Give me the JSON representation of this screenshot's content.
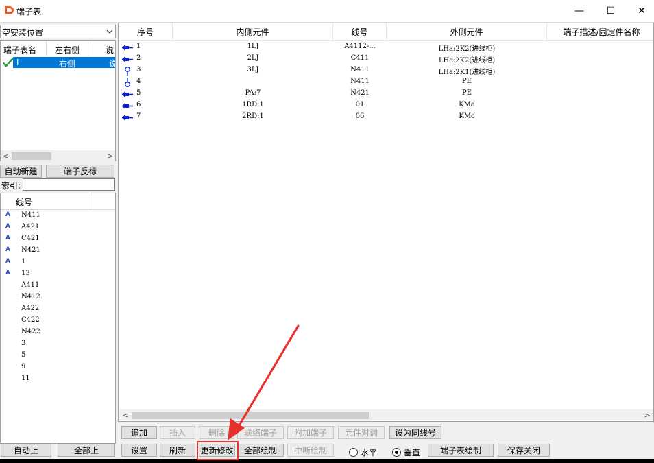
{
  "window": {
    "title": "端子表",
    "minimize": "—",
    "maximize": "☐",
    "close": "✕"
  },
  "left": {
    "combo_value": "空安装位置",
    "terminal_list": {
      "columns": [
        "端子表名",
        "左右侧",
        "说"
      ],
      "rows": [
        {
          "name": "I",
          "side": "右侧",
          "extra": "说"
        }
      ]
    },
    "buttons": {
      "auto_new": "自动新建",
      "reverse": "端子反标"
    },
    "search": {
      "label": "索引:",
      "value": ""
    },
    "wire_list": {
      "column": "线号",
      "items": [
        {
          "text": "N411",
          "flag": "A"
        },
        {
          "text": "A421",
          "flag": "A"
        },
        {
          "text": "C421",
          "flag": "A"
        },
        {
          "text": "N421",
          "flag": "A"
        },
        {
          "text": "1",
          "flag": "A"
        },
        {
          "text": "13",
          "flag": "A"
        },
        {
          "text": "A411",
          "flag": ""
        },
        {
          "text": "N412",
          "flag": ""
        },
        {
          "text": "A422",
          "flag": ""
        },
        {
          "text": "C422",
          "flag": ""
        },
        {
          "text": "N422",
          "flag": ""
        },
        {
          "text": "3",
          "flag": ""
        },
        {
          "text": "5",
          "flag": ""
        },
        {
          "text": "9",
          "flag": ""
        },
        {
          "text": "11",
          "flag": ""
        }
      ]
    },
    "bottom_buttons": {
      "auto_up": "自动上",
      "all_up": "全部上"
    }
  },
  "table": {
    "columns": [
      "序号",
      "内侧元件",
      "线号",
      "外侧元件",
      "端子描述/固定件名称"
    ],
    "rows": [
      {
        "no": "1",
        "inner": "1LJ",
        "wire": "A4112-...",
        "outer": "LHa:2K2(进线柜)",
        "desc": "",
        "icon": "arrow"
      },
      {
        "no": "2",
        "inner": "2LJ",
        "wire": "C411",
        "outer": "LHc:2K2(进线柜)",
        "desc": "",
        "icon": "arrow"
      },
      {
        "no": "3",
        "inner": "3LJ",
        "wire": "N411",
        "outer": "LHa:2K1(进线柜)",
        "desc": "",
        "icon": "link-top"
      },
      {
        "no": "4",
        "inner": "",
        "wire": "N411",
        "outer": "PE",
        "desc": "",
        "icon": "link-bottom"
      },
      {
        "no": "5",
        "inner": "PA:7",
        "wire": "N421",
        "outer": "PE",
        "desc": "",
        "icon": "arrow"
      },
      {
        "no": "6",
        "inner": "1RD:1",
        "wire": "01",
        "outer": "KMa",
        "desc": "",
        "icon": "arrow"
      },
      {
        "no": "7",
        "inner": "2RD:1",
        "wire": "06",
        "outer": "KMc",
        "desc": "",
        "icon": "arrow"
      }
    ]
  },
  "toolbar_row1": [
    "追加",
    "插入",
    "删除",
    "联络端子",
    "附加端子",
    "元件对调",
    "设为同线号"
  ],
  "toolbar_row2": [
    "设置",
    "刷新",
    "更新修改",
    "全部绘制",
    "中断绘制"
  ],
  "orientation": {
    "horizontal": "水平",
    "vertical": "垂直",
    "selected": "vertical"
  },
  "toolbar_row2_right": [
    "端子表绘制",
    "保存关闭"
  ],
  "colors": {
    "selection": "#0078d7",
    "highlight": "#e8302d",
    "icon_blue": "#0a1fd6"
  }
}
